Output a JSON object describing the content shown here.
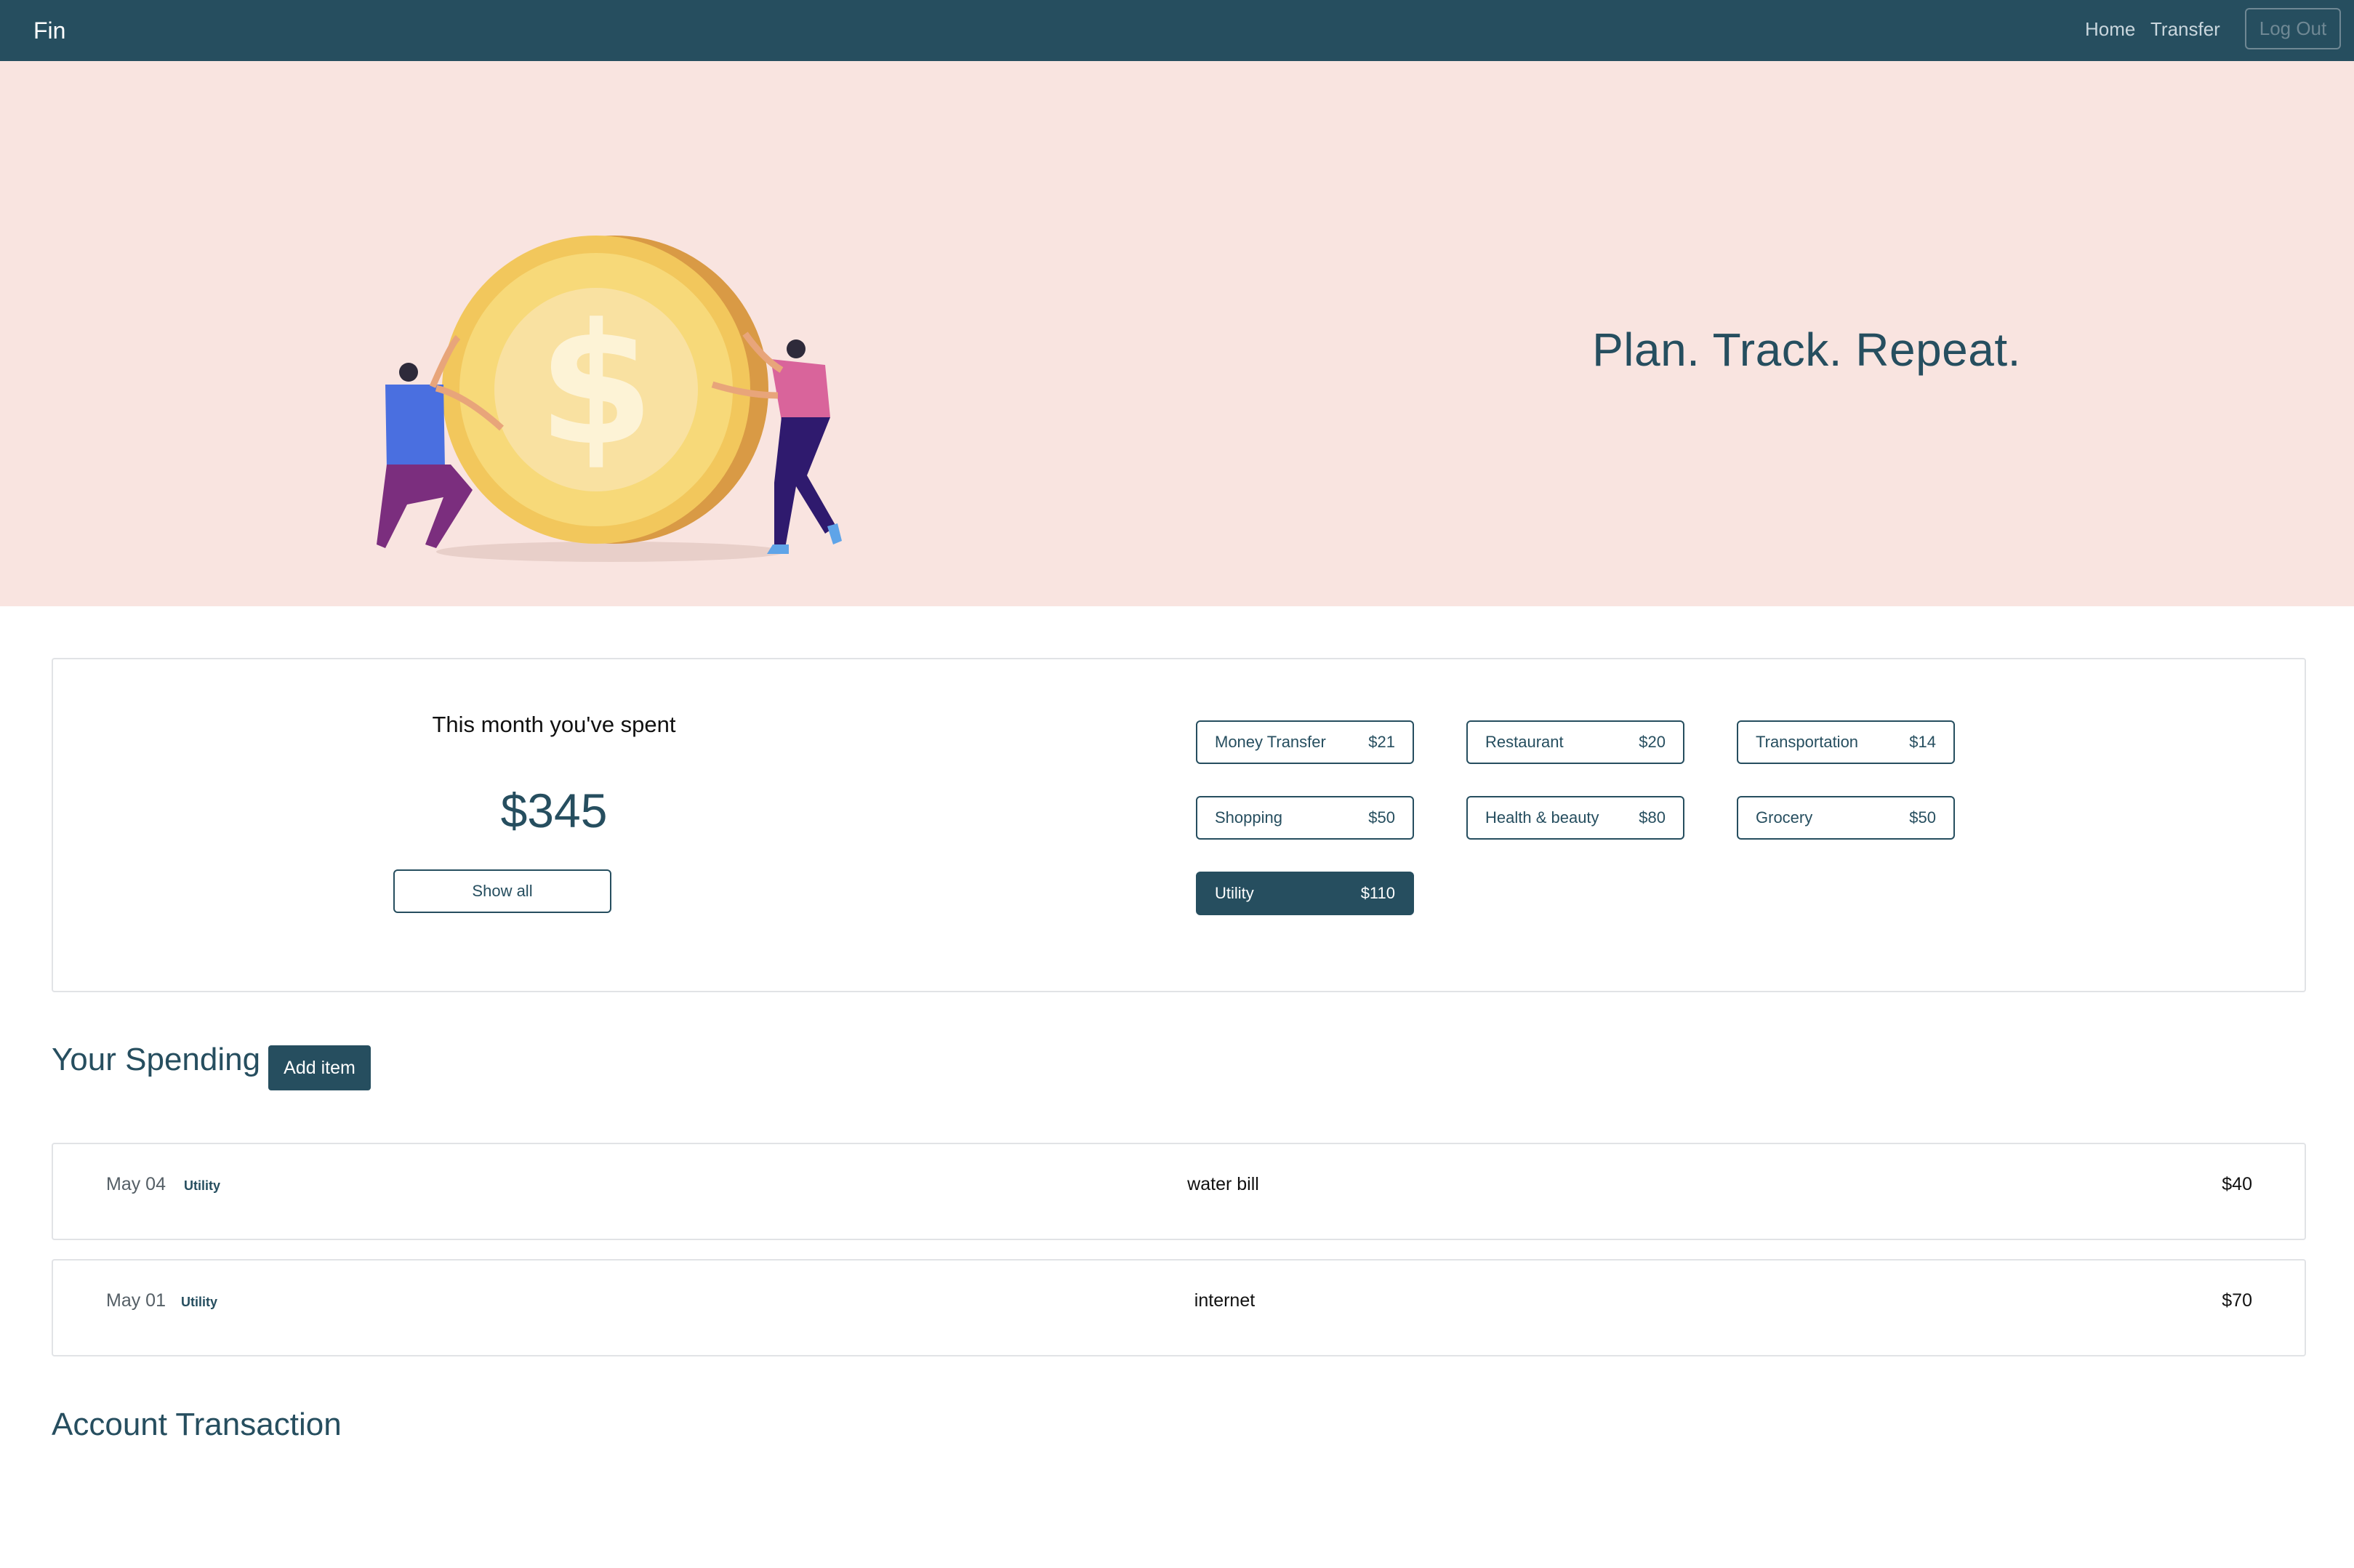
{
  "navbar": {
    "brand": "Fin",
    "links": [
      {
        "label": "Home"
      },
      {
        "label": "Transfer"
      }
    ],
    "logout_label": "Log Out"
  },
  "hero": {
    "tagline": "Plan. Track. Repeat.",
    "illustration_icon": "coin-pushing-illustration"
  },
  "summary": {
    "heading": "This month you've spent",
    "total": "$345",
    "show_all_label": "Show all",
    "categories": [
      {
        "name": "Money Transfer",
        "amount": "$21",
        "active": false
      },
      {
        "name": "Restaurant",
        "amount": "$20",
        "active": false
      },
      {
        "name": "Transportation",
        "amount": "$14",
        "active": false
      },
      {
        "name": "Shopping",
        "amount": "$50",
        "active": false
      },
      {
        "name": "Health & beauty",
        "amount": "$80",
        "active": false
      },
      {
        "name": "Grocery",
        "amount": "$50",
        "active": false
      },
      {
        "name": "Utility",
        "amount": "$110",
        "active": true
      }
    ]
  },
  "spending": {
    "title": "Your Spending",
    "add_item_label": "Add item",
    "items": [
      {
        "date": "May 04",
        "category": "Utility",
        "description": "water bill",
        "amount": "$40"
      },
      {
        "date": "May 01",
        "category": "Utility",
        "description": "internet",
        "amount": "$70"
      }
    ]
  },
  "account": {
    "title": "Account Transaction"
  },
  "colors": {
    "primary": "#264e5f",
    "hero_bg": "#f9e4e0",
    "coin": "#f2c75c"
  }
}
